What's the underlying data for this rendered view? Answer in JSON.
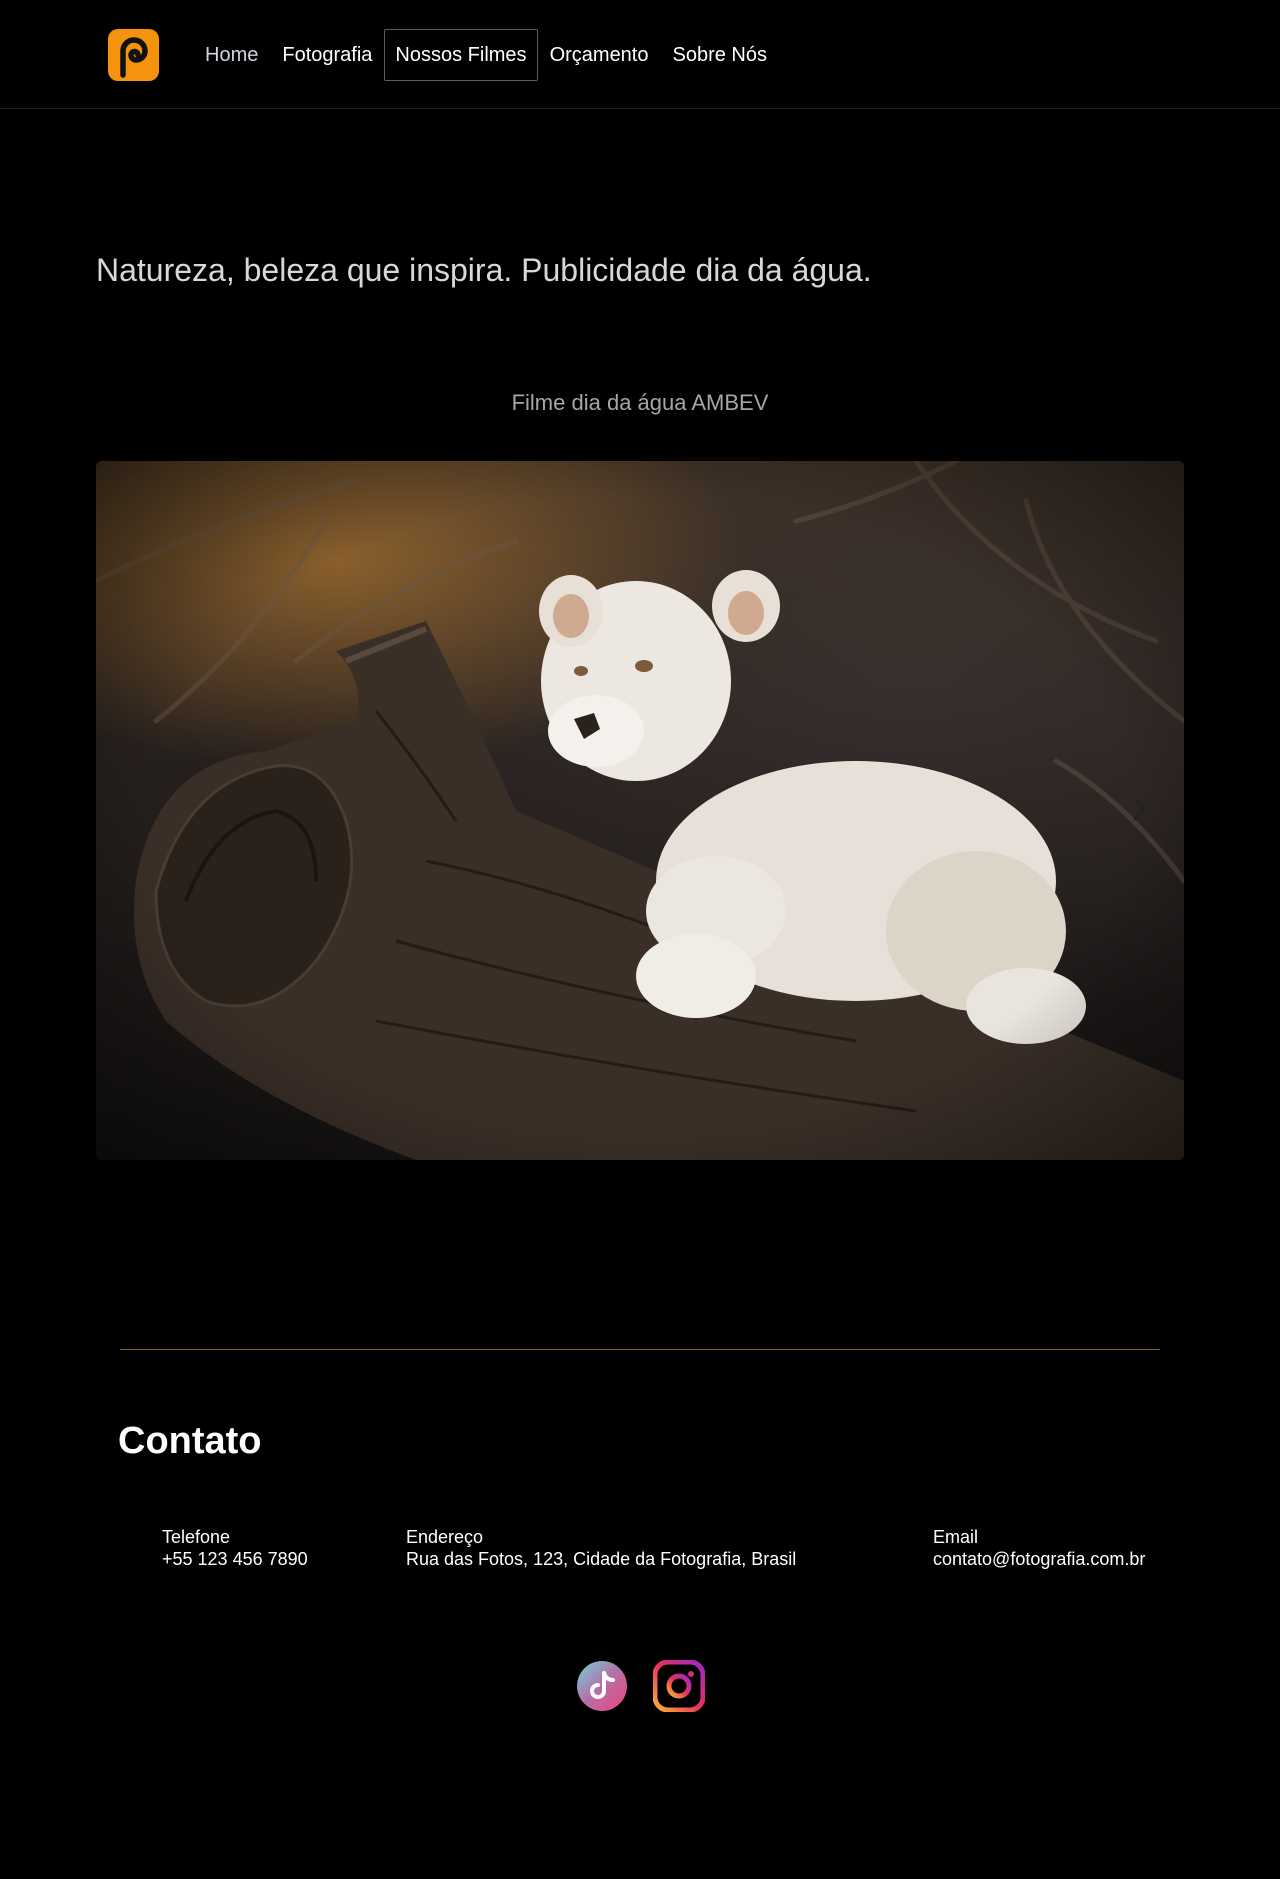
{
  "nav": {
    "items": [
      {
        "label": "Home"
      },
      {
        "label": "Fotografia"
      },
      {
        "label": "Nossos Filmes"
      },
      {
        "label": "Orçamento"
      },
      {
        "label": "Sobre Nós"
      }
    ],
    "active": "Nossos Filmes"
  },
  "main": {
    "headline": "Natureza, beleza que inspira. Publicidade dia da água.",
    "film_title": "Filme dia da água AMBEV",
    "carousel": {
      "prev_icon": "chevron-left-icon",
      "next_icon": "chevron-right-icon"
    }
  },
  "contact": {
    "title": "Contato",
    "phone": {
      "label": "Telefone",
      "value": "+55 123 456 7890"
    },
    "address": {
      "label": "Endereço",
      "value": "Rua das Fotos, 123, Cidade da Fotografia, Brasil"
    },
    "email": {
      "label": "Email",
      "value": "contato@fotografia.com.br"
    }
  },
  "social": {
    "icons": [
      "tiktok-icon",
      "instagram-icon"
    ]
  },
  "colors": {
    "background": "#000000",
    "brand_orange": "#f5930f",
    "divider": "#8a5a10",
    "headline_text": "#d8d8d8",
    "muted_text": "#a6a6a6"
  }
}
